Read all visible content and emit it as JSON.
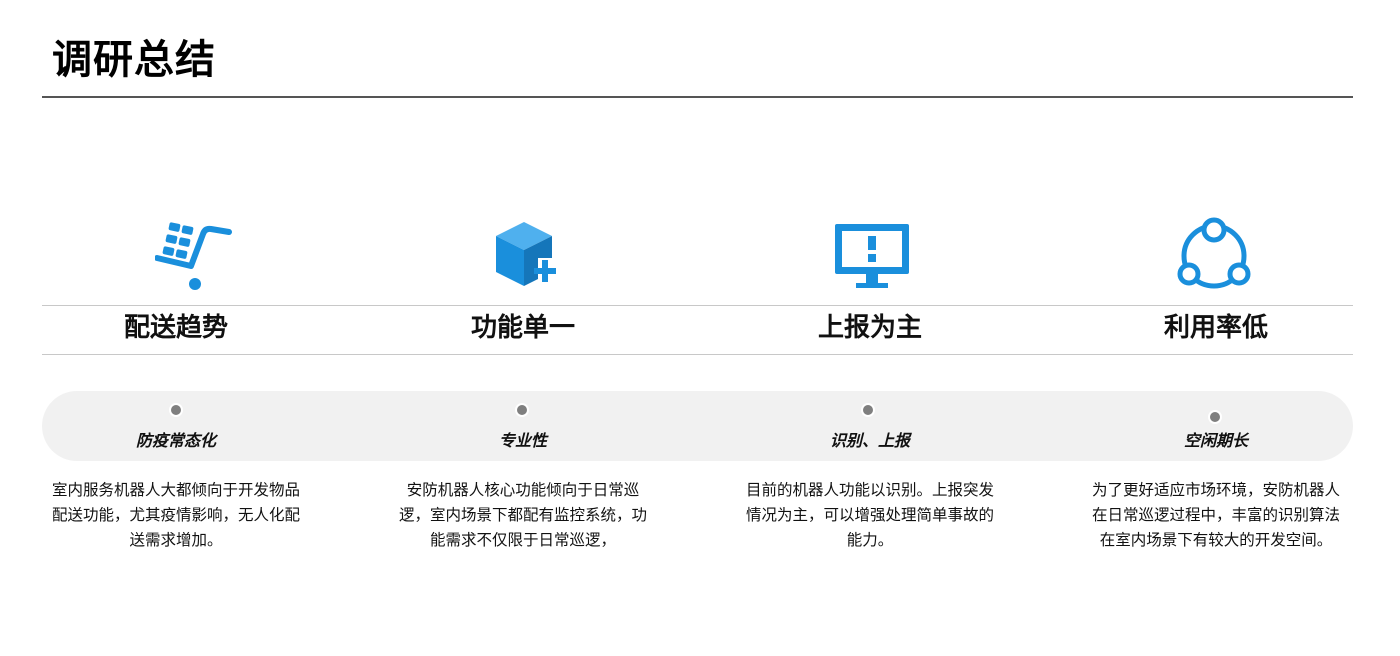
{
  "page": {
    "title": "调研总结",
    "accent_color": "#1a8fdc"
  },
  "columns": [
    {
      "icon": "delivery-cart-icon",
      "heading": "配送趋势",
      "subtitle": "防疫常态化",
      "description": "室内服务机器人大都倾向于开发物品配送功能，尤其疫情影响，无人化配送需求增加。"
    },
    {
      "icon": "cube-plus-icon",
      "heading": "功能单一",
      "subtitle": "专业性",
      "description": "安防机器人核心功能倾向于日常巡逻，室内场景下都配有监控系统，功能需求不仅限于日常巡逻，"
    },
    {
      "icon": "monitor-alert-icon",
      "heading": "上报为主",
      "subtitle": "识别、上报",
      "description": "目前的机器人功能以识别。上报突发情况为主，可以增强处理简单事故的能力。"
    },
    {
      "icon": "share-nodes-icon",
      "heading": "利用率低",
      "subtitle": "空闲期长",
      "description": "为了更好适应市场环境，安防机器人在日常巡逻过程中，丰富的识别算法在室内场景下有较大的开发空间。"
    }
  ]
}
